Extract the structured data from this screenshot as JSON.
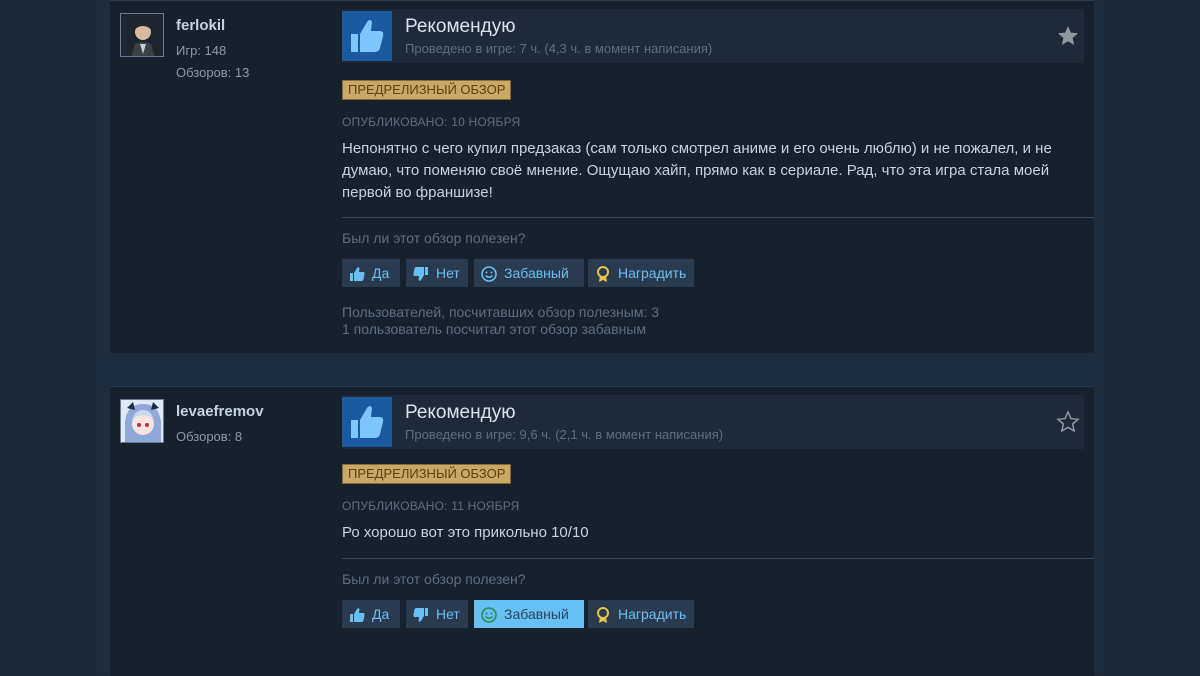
{
  "reviews": [
    {
      "author": {
        "name": "ferlokil",
        "games": "Игр: 148",
        "reviews": "Обзоров: 13"
      },
      "recommendation": "Рекомендую",
      "playtime": "Проведено в игре: 7 ч. (4,3 ч. в момент написания)",
      "badge": "ПРЕДРЕЛИЗНЫЙ ОБЗОР",
      "posted": "ОПУБЛИКОВАНО: 10 НОЯБРЯ",
      "content": "Непонятно с чего купил предзаказ (сам только смотрел аниме и его очень люблю) и не пожалел, и не думаю, что поменяю своё мнение. Ощущаю хайп, прямо как в сериале. Рад, что эта игра стала моей первой во франшизе!",
      "helpful_question": "Был ли этот обзор полезен?",
      "buttons": {
        "yes": "Да",
        "no": "Нет",
        "funny": "Забавный",
        "award": "Наградить"
      },
      "stats_helpful": "Пользователей, посчитавших обзор полезным: 3",
      "stats_funny": "1 пользователь посчитал этот обзор забавным"
    },
    {
      "author": {
        "name": "levaefremov",
        "reviews": "Обзоров: 8"
      },
      "recommendation": "Рекомендую",
      "playtime": "Проведено в игре: 9,6 ч. (2,1 ч. в момент написания)",
      "badge": "ПРЕДРЕЛИЗНЫЙ ОБЗОР",
      "posted": "ОПУБЛИКОВАНО: 11 НОЯБРЯ",
      "content": "Ро хорошо вот это прикольно 10/10",
      "helpful_question": "Был ли этот обзор полезен?",
      "buttons": {
        "yes": "Да",
        "no": "Нет",
        "funny": "Забавный",
        "award": "Наградить"
      },
      "funny_selected": true
    }
  ],
  "icons": {
    "thumbs_up": "thumbs-up-icon",
    "thumbs_down": "thumbs-down-icon",
    "smiley": "smiley-icon",
    "award": "award-ribbon-icon",
    "star": "star-icon"
  },
  "colors": {
    "accent": "#66c0f4",
    "badge": "#c8a96a",
    "background": "#1b2838"
  }
}
